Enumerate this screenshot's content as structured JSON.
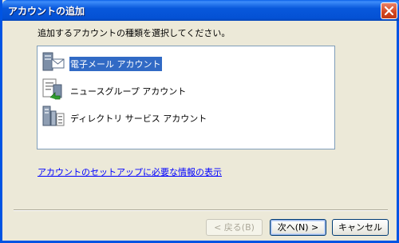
{
  "window": {
    "title": "アカウントの追加",
    "close_icon": "close-icon"
  },
  "instruction": "追加するアカウントの種類を選択してください。",
  "accounts": [
    {
      "label": "電子メール アカウント",
      "icon": "email-account-icon",
      "selected": true
    },
    {
      "label": "ニュースグループ アカウント",
      "icon": "newsgroup-account-icon",
      "selected": false
    },
    {
      "label": "ディレクトリ サービス アカウント",
      "icon": "directory-service-icon",
      "selected": false
    }
  ],
  "info_link": "アカウントのセットアップに必要な情報の表示",
  "buttons": {
    "back": "< 戻る(B)",
    "next": "次へ(N) >",
    "cancel": "キャンセル"
  },
  "colors": {
    "titlebar": "#0054e3",
    "selection": "#316ac5",
    "link": "#0000ff"
  }
}
